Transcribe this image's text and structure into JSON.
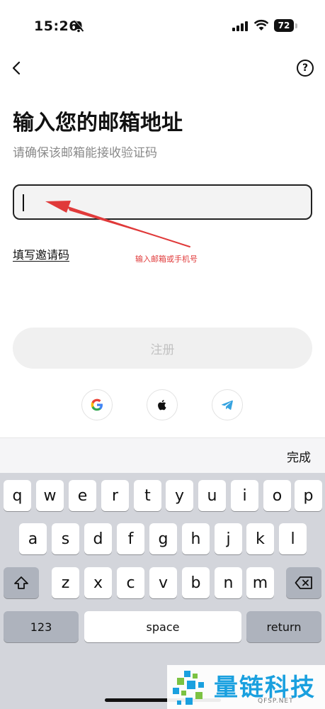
{
  "status_bar": {
    "time": "15:26",
    "battery": "72"
  },
  "page": {
    "title": "输入您的邮箱地址",
    "subtitle": "请确保该邮箱能接收验证码",
    "email_input_value": "",
    "invite_link": "填写邀请码",
    "annotation": "输入邮箱或手机号",
    "register_button": "注册",
    "social": [
      "google-icon",
      "apple-icon",
      "telegram-icon"
    ]
  },
  "keyboard": {
    "done_label": "完成",
    "row1": [
      "q",
      "w",
      "e",
      "r",
      "t",
      "y",
      "u",
      "i",
      "o",
      "p"
    ],
    "row2": [
      "a",
      "s",
      "d",
      "f",
      "g",
      "h",
      "j",
      "k",
      "l"
    ],
    "row3": [
      "z",
      "x",
      "c",
      "v",
      "b",
      "n",
      "m"
    ],
    "numbers_key": "123",
    "space_key": "space",
    "return_key": "return"
  },
  "watermark": {
    "title": "量链科技",
    "subtitle": "QFSP.NET"
  },
  "colors": {
    "annotation": "#e03a3a",
    "watermark": "#1aa0df"
  }
}
